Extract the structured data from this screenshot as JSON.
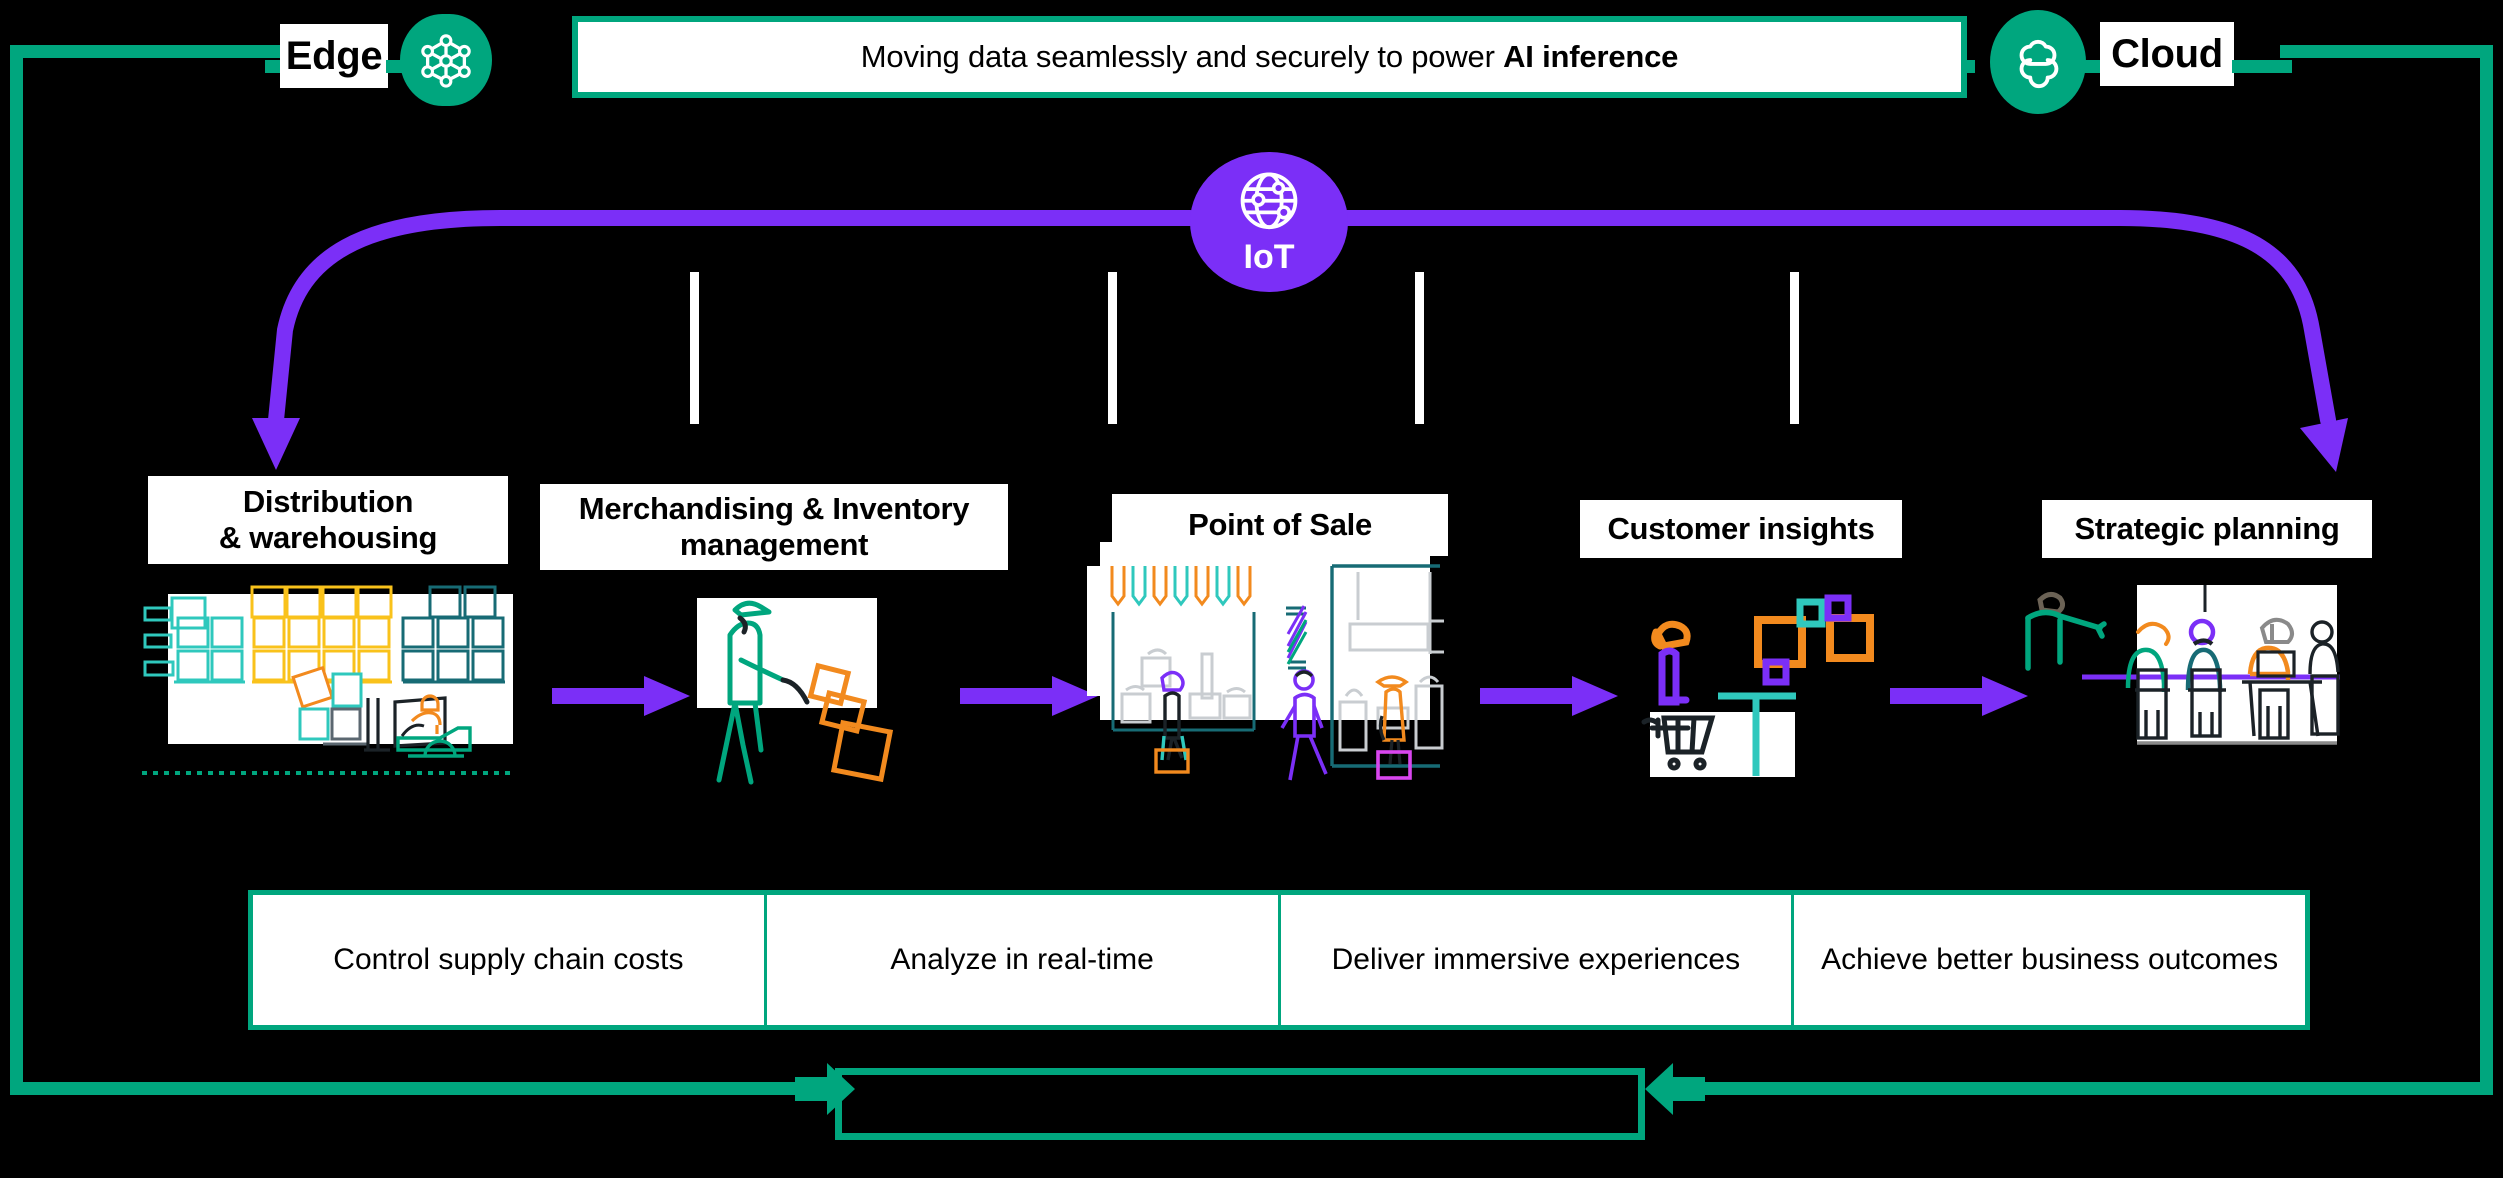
{
  "theme": {
    "background": "#000000",
    "accent_green": "#00a67e",
    "accent_purple": "#7b2ff7",
    "accent_orange": "#f28a1e",
    "accent_teal": "#2fc8bd",
    "accent_yellow": "#f9c21b",
    "chip_bg": "#ffffff",
    "chip_text": "#000000"
  },
  "header": {
    "edge_label": "Edge",
    "cloud_label": "Cloud",
    "edge_icon": "network-mesh-icon",
    "cloud_icon": "cloud-icon",
    "banner_text_normal": "Moving data seamlessly and securely to power ",
    "banner_text_strong": "AI inference"
  },
  "iot": {
    "label": "IoT",
    "icon": "globe-network-icon"
  },
  "stages": [
    {
      "id": "distribution-warehousing",
      "label_line1": "Distribution",
      "label_line2": "& warehousing",
      "illustration": "warehouse-forklift-illustration"
    },
    {
      "id": "merchandising-inventory",
      "label_line1": "Merchandising & Inventory",
      "label_line2": "management",
      "illustration": "worker-handtruck-illustration"
    },
    {
      "id": "point-of-sale",
      "label_line1": "Point of Sale",
      "label_line2": "",
      "illustration": "storefront-shoppers-illustration"
    },
    {
      "id": "customer-insights",
      "label_line1": "Customer insights",
      "label_line2": "",
      "illustration": "shopper-data-squares-illustration"
    },
    {
      "id": "strategic-planning",
      "label_line1": "Strategic planning",
      "label_line2": "",
      "illustration": "meeting-presentation-illustration"
    }
  ],
  "benefits": [
    {
      "id": "control-supply-chain-costs",
      "text": "Control supply chain costs"
    },
    {
      "id": "analyze-in-real-time",
      "text": "Analyze in real-time"
    },
    {
      "id": "deliver-immersive-experiences",
      "text": "Deliver immersive experiences"
    },
    {
      "id": "achieve-better-business-outcomes",
      "text": "Achieve better business outcomes"
    }
  ],
  "bottom_box": {
    "text": ""
  }
}
